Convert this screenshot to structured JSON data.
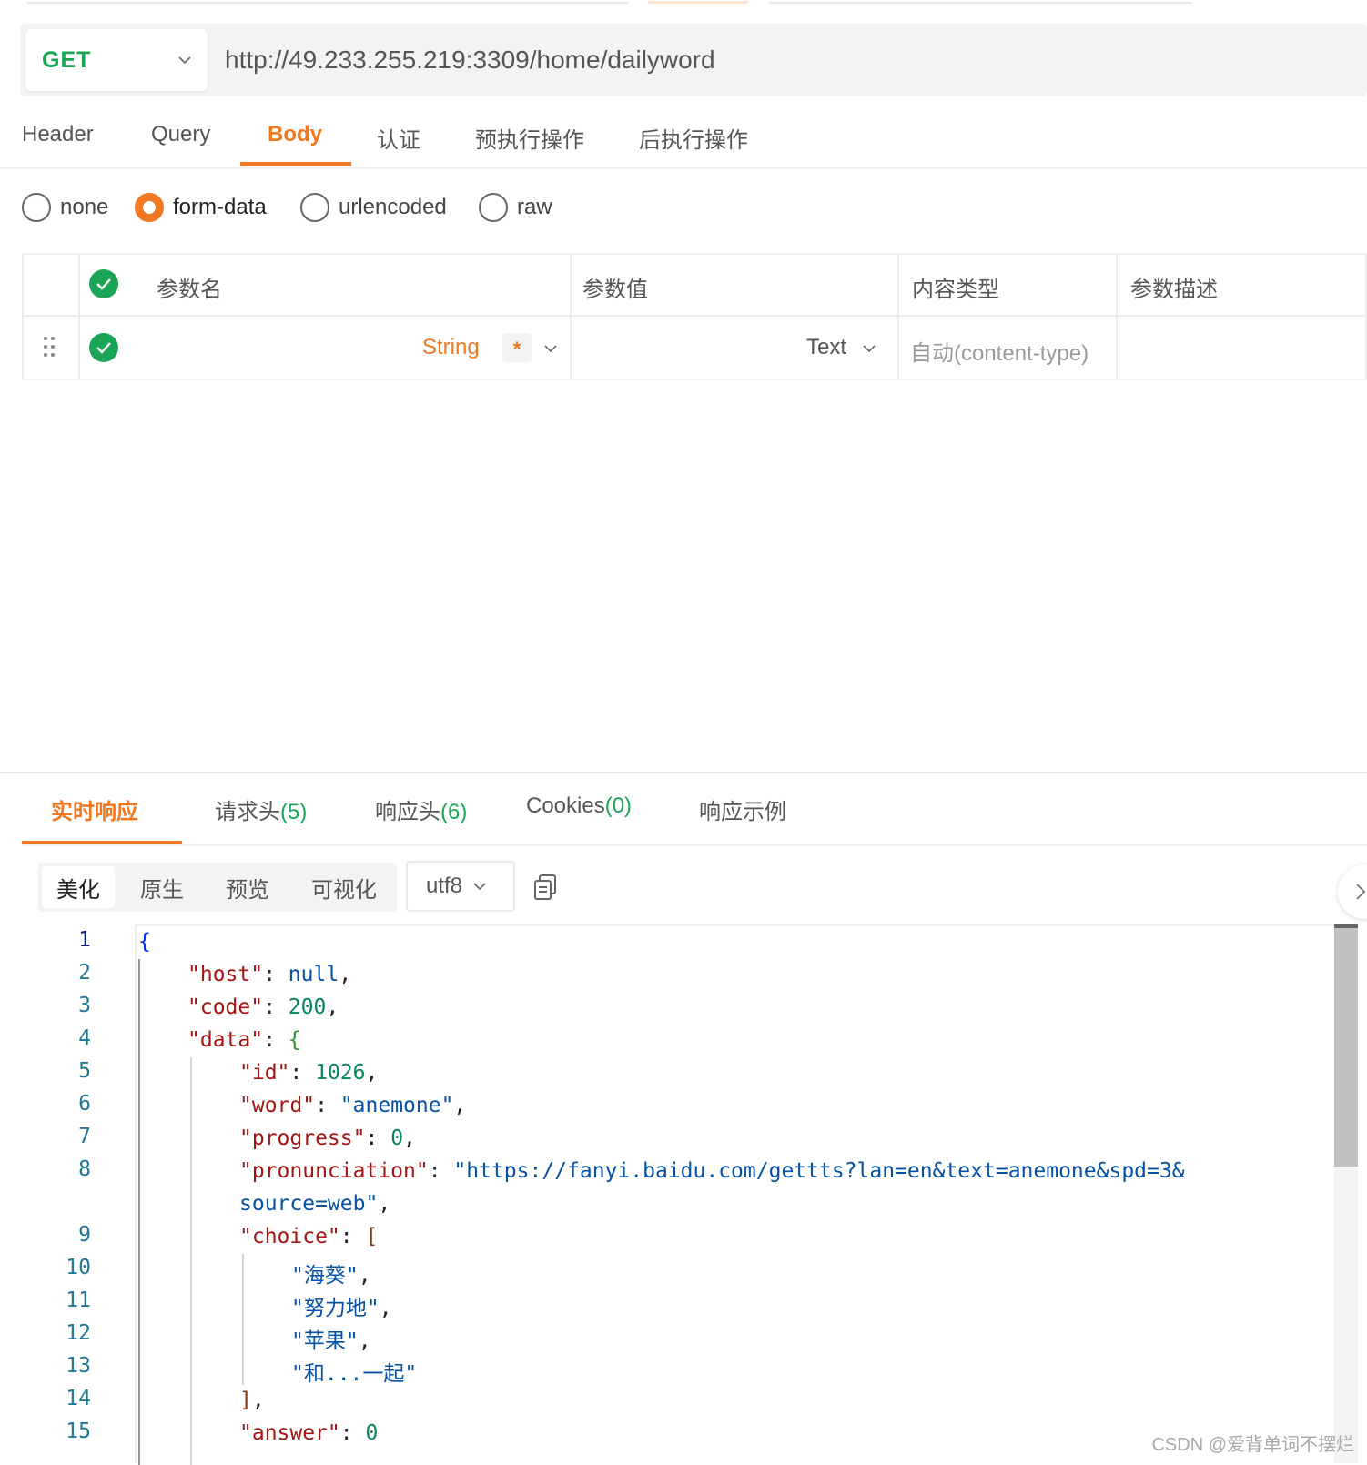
{
  "request": {
    "method": "GET",
    "url": "http://49.233.255.219:3309/home/dailyword",
    "tabs": [
      "Header",
      "Query",
      "Body",
      "认证",
      "预执行操作",
      "后执行操作"
    ],
    "active_tab": "Body",
    "body_types": [
      "none",
      "form-data",
      "urlencoded",
      "raw"
    ],
    "selected_body_type": "form-data"
  },
  "params_table": {
    "headers": [
      "参数名",
      "参数值",
      "内容类型",
      "参数描述"
    ],
    "row": {
      "name_type": "String",
      "required_mark": "*",
      "value_type": "Text",
      "content_type_placeholder": "自动(content-type)"
    }
  },
  "response": {
    "tabs": [
      {
        "label": "实时响应",
        "count": ""
      },
      {
        "label": "请求头",
        "count": "(5)"
      },
      {
        "label": "响应头",
        "count": "(6)"
      },
      {
        "label": "Cookies",
        "count": "(0)"
      },
      {
        "label": "响应示例",
        "count": ""
      }
    ],
    "view_modes": [
      "美化",
      "原生",
      "预览",
      "可视化"
    ],
    "active_view": "美化",
    "encoding": "utf8",
    "code": {
      "line_numbers": [
        "1",
        "2",
        "3",
        "4",
        "5",
        "6",
        "7",
        "8",
        "9",
        "10",
        "11",
        "12",
        "13",
        "14",
        "15"
      ],
      "host_key": "\"host\"",
      "host_val": "null",
      "code_key": "\"code\"",
      "code_val": "200",
      "data_key": "\"data\"",
      "id_key": "\"id\"",
      "id_val": "1026",
      "word_key": "\"word\"",
      "word_val": "\"anemone\"",
      "progress_key": "\"progress\"",
      "progress_val": "0",
      "pron_key": "\"pronunciation\"",
      "pron_val_1": "\"https://fanyi.baidu.com/gettts?lan=en&text=anemone&spd=3&",
      "pron_val_2": "source=web\"",
      "choice_key": "\"choice\"",
      "choices": [
        "\"海葵\"",
        "\"努力地\"",
        "\"苹果\"",
        "\"和...一起\""
      ],
      "answer_key": "\"answer\"",
      "answer_val": "0"
    }
  },
  "watermark": "CSDN @爱背单词不摆烂",
  "colors": {
    "accent": "#f07820",
    "get_green": "#1aa556"
  }
}
